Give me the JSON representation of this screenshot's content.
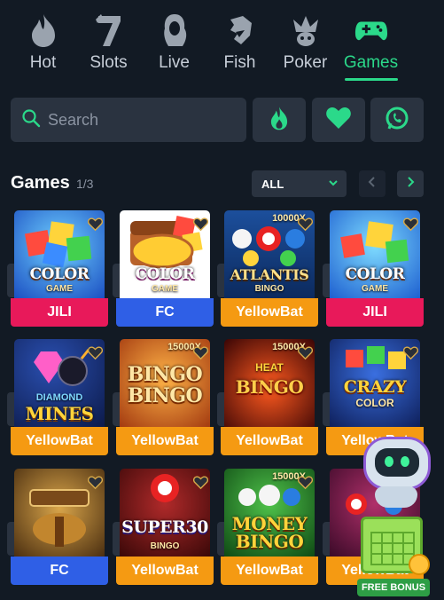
{
  "nav": {
    "items": [
      {
        "label": "Hot",
        "icon": "flame-icon"
      },
      {
        "label": "Slots",
        "icon": "lucky-seven-icon"
      },
      {
        "label": "Live",
        "icon": "dealer-icon"
      },
      {
        "label": "Fish",
        "icon": "shark-icon"
      },
      {
        "label": "Poker",
        "icon": "jester-icon"
      },
      {
        "label": "Games",
        "icon": "gamepad-icon"
      }
    ],
    "active": "Games"
  },
  "search": {
    "placeholder": "Search"
  },
  "quick_buttons": [
    "flame-icon",
    "heart-icon",
    "whatsapp-icon"
  ],
  "games_section": {
    "title": "Games",
    "page": "1/3",
    "filter": "ALL"
  },
  "games": [
    {
      "title": "COLOR",
      "subtitle": "GAME",
      "provider": "JILI"
    },
    {
      "title": "COLOR",
      "subtitle": "GAME",
      "provider": "FC"
    },
    {
      "title": "ATLANTIS",
      "subtitle": "BINGO",
      "provider": "YellowBat",
      "multiplier": "10000X"
    },
    {
      "title": "COLOR",
      "subtitle": "GAME",
      "provider": "JILI"
    },
    {
      "title": "MINES",
      "subtitle": "DIAMOND",
      "provider": "YellowBat"
    },
    {
      "title": "BINGO",
      "subtitle": "BINGO",
      "provider": "YellowBat",
      "multiplier": "15000X"
    },
    {
      "title": "BINGO",
      "subtitle": "HEAT",
      "provider": "YellowBat",
      "multiplier": "15000X"
    },
    {
      "title": "CRAZY",
      "subtitle": "COLOR",
      "provider": "YellowBat"
    },
    {
      "title": "",
      "subtitle": "",
      "provider": "FC"
    },
    {
      "title": "SUPER30",
      "subtitle": "BINGO",
      "provider": "YellowBat"
    },
    {
      "title": "MONEY",
      "subtitle": "BINGO",
      "provider": "YellowBat",
      "multiplier": "15000X"
    },
    {
      "title": "",
      "subtitle": "",
      "provider": "YellowBat"
    }
  ],
  "bonus": {
    "label": "FREE BONUS"
  },
  "colors": {
    "accent": "#2bd98a",
    "bg": "#121a24",
    "panel": "#2a3340",
    "jili": "#e8195a",
    "fc": "#2f5fe6",
    "yellowbat": "#f59a12"
  }
}
